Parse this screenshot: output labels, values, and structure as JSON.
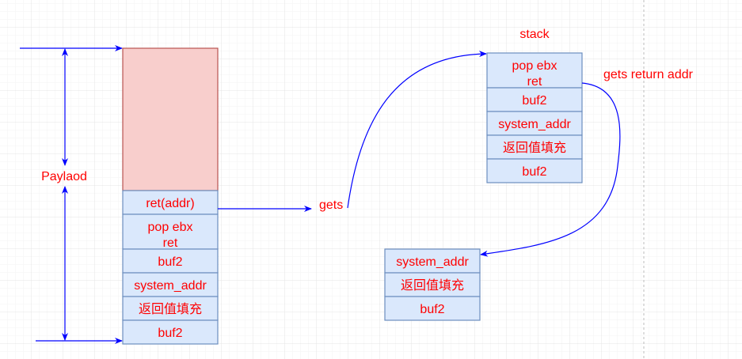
{
  "labels": {
    "payload": "Paylaod",
    "gets": "gets",
    "stack": "stack",
    "gets_return_addr": "gets return addr"
  },
  "left_stack": {
    "cells": [
      "ret(addr)",
      "pop ebx",
      "ret",
      "buf2",
      "system_addr",
      "返回值填充",
      "buf2"
    ]
  },
  "right_stack": {
    "cells": [
      "pop ebx",
      "ret",
      "buf2",
      "system_addr",
      "返回值填充",
      "buf2"
    ]
  },
  "bottom_stack": {
    "cells": [
      "system_addr",
      "返回值填充",
      "buf2"
    ]
  },
  "colors": {
    "text": "#ff0000",
    "arrow": "#0000ff",
    "padding_fill": "#f8cecc",
    "cell_fill": "#dae8fc",
    "cell_stroke": "#6c8ebf"
  }
}
